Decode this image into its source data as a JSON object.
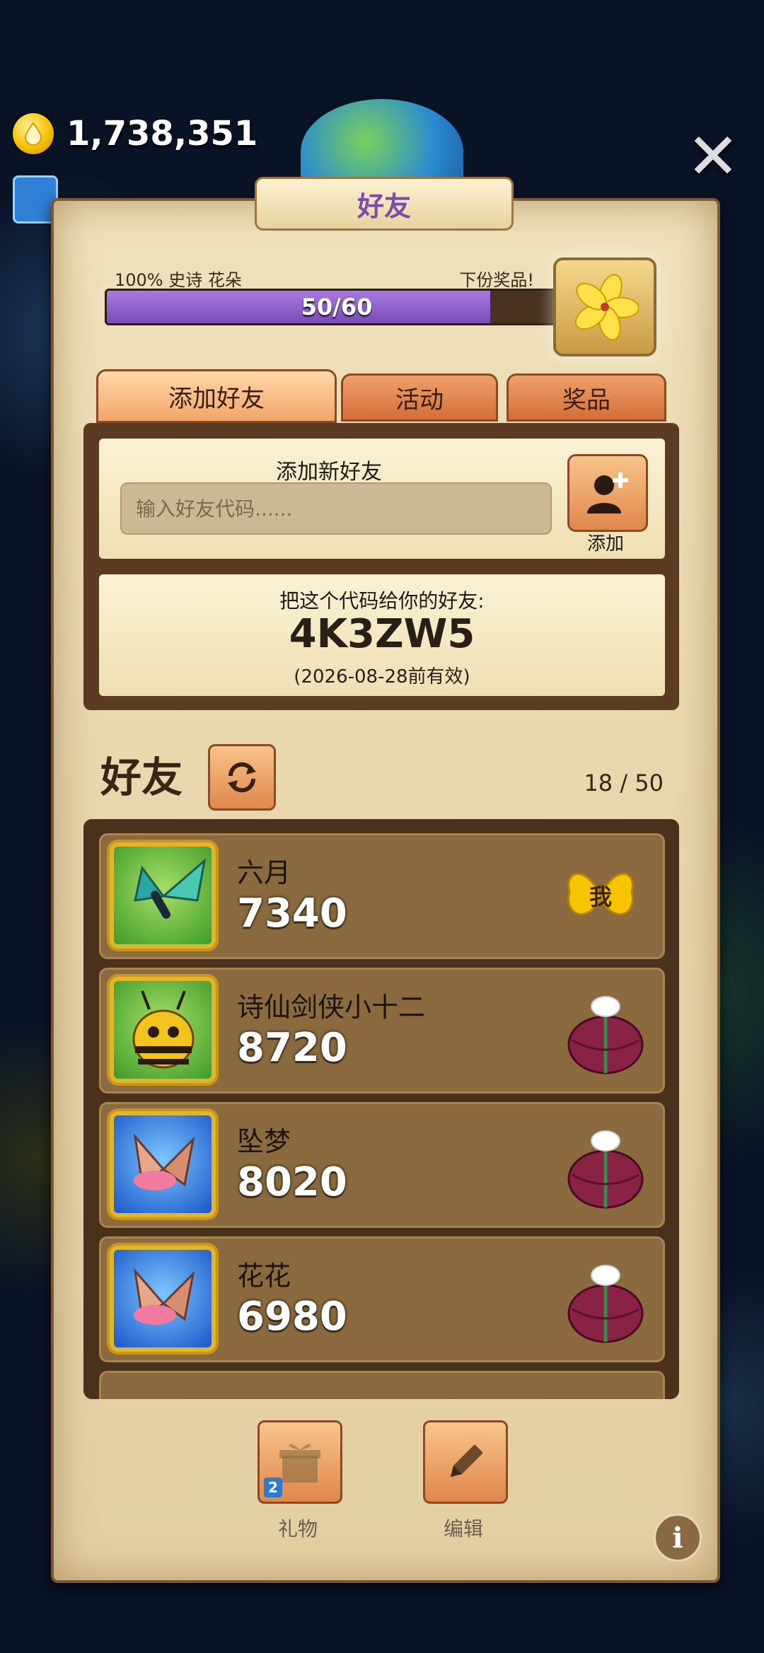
{
  "hud": {
    "coins": "1,738,351"
  },
  "header": {
    "title": "好友"
  },
  "progress": {
    "label": "100% 史诗 花朵",
    "next_label": "下份奖品!",
    "value_text": "50/60",
    "current": 50,
    "max": 60
  },
  "tabs": [
    {
      "label": "添加好友",
      "active": true
    },
    {
      "label": "活动",
      "active": false
    },
    {
      "label": "奖品",
      "active": false
    }
  ],
  "add_friend": {
    "title": "添加新好友",
    "placeholder": "输入好友代码......",
    "button_label": "添加"
  },
  "share_code": {
    "title": "把这个代码给你的好友:",
    "code": "4K3ZW5",
    "expiry": "(2026-08-28前有效)"
  },
  "friends": {
    "title": "好友",
    "count": "18 / 50",
    "items": [
      {
        "name": "六月",
        "score": "7340",
        "avatar": "butterfly-avatar-icon",
        "badge": "我"
      },
      {
        "name": "诗仙剑侠小十二",
        "score": "8720",
        "avatar": "bee-avatar-icon",
        "badge": "gift"
      },
      {
        "name": "坠梦",
        "score": "8020",
        "avatar": "moth-avatar-icon",
        "badge": "gift"
      },
      {
        "name": "花花",
        "score": "6980",
        "avatar": "moth-avatar-icon",
        "badge": "gift"
      }
    ]
  },
  "footer": {
    "gift_label": "礼物",
    "gift_count": "2",
    "edit_label": "编辑",
    "info_symbol": "i"
  },
  "colors": {
    "progress_fill": "#8a5cc8",
    "tab_active": "#f6b27c",
    "panel": "#ead9ae"
  }
}
